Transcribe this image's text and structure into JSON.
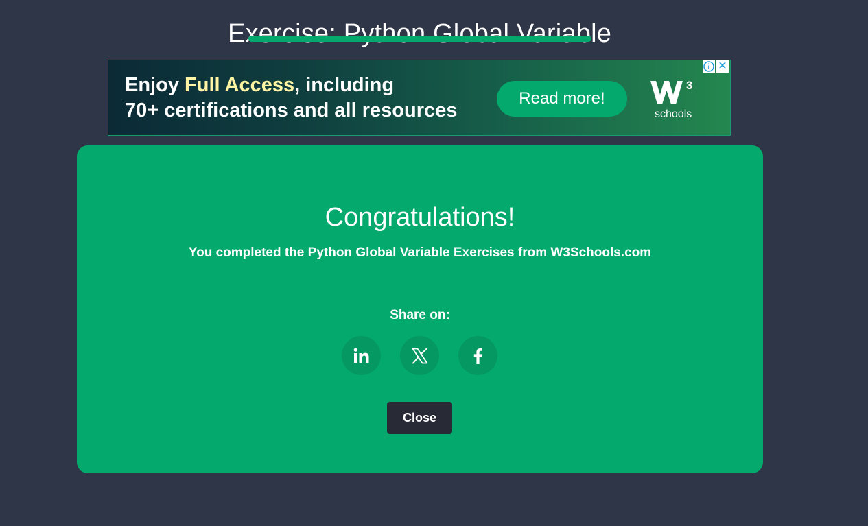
{
  "header": {
    "title": "Exercise: Python Global Variable"
  },
  "ad": {
    "line1_prefix": "Enjoy ",
    "line1_highlight": "Full Access",
    "line1_suffix": ", including",
    "line2": "70+ certifications and all resources",
    "button_label": "Read more!",
    "logo_word": "schools",
    "close_glyph": "✕"
  },
  "modal": {
    "title": "Congratulations!",
    "message": "You completed the Python Global Variable Exercises from W3Schools.com",
    "share_label": "Share on:",
    "share_targets": [
      "linkedin-icon",
      "x-icon",
      "facebook-icon"
    ],
    "close_label": "Close"
  },
  "colors": {
    "background": "#2f3647",
    "accent": "#04aa6d",
    "highlight": "#fff4a3",
    "close_button": "#282a35"
  }
}
